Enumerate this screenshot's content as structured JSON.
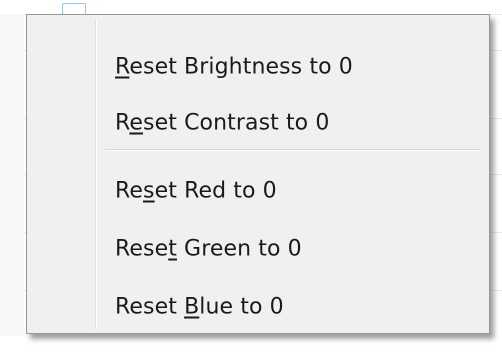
{
  "context_menu": {
    "items": [
      {
        "label": "Reset Brightness to 0",
        "mnemonic_index": 0
      },
      {
        "label": "Reset Contrast to 0",
        "mnemonic_index": 1
      },
      {
        "label": "Reset Red to 0",
        "mnemonic_index": 2
      },
      {
        "label": "Reset Green to 0",
        "mnemonic_index": 4
      },
      {
        "label": "Reset Blue to 0",
        "mnemonic_index": 6
      }
    ],
    "separator_after_index": 1
  },
  "colors": {
    "menu_background": "#f0f0f0",
    "menu_border": "#979797",
    "text": "#1a1a1a",
    "background_square_border": "#9ec3e6"
  }
}
